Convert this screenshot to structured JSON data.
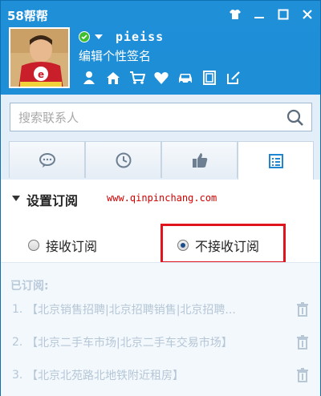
{
  "app": {
    "title": "58帮帮"
  },
  "profile": {
    "username": "pieiss",
    "signature": "编辑个性签名",
    "status": "online"
  },
  "quick_icons": [
    "person-icon",
    "home-icon",
    "cart-icon",
    "heart-icon",
    "car-icon",
    "notebook-icon",
    "edit-icon"
  ],
  "search": {
    "placeholder": "搜索联系人"
  },
  "tabs": [
    {
      "name": "chat-icon"
    },
    {
      "name": "clock-icon"
    },
    {
      "name": "thumbs-up-icon"
    },
    {
      "name": "list-icon",
      "active": true
    }
  ],
  "subscription": {
    "section_title": "设置订阅",
    "watermark": "www.qinpinchang.com",
    "option_accept": "接收订阅",
    "option_reject": "不接收订阅",
    "selected": "reject",
    "subscribed_label": "已订阅:",
    "items": [
      {
        "num": "1.",
        "text": "【北京销售招聘|北京招聘销售|北京招聘..."
      },
      {
        "num": "2.",
        "text": "【北京二手车市场|北京二手车交易市场】"
      },
      {
        "num": "3.",
        "text": "【北京北苑路北地铁附近租房】"
      }
    ]
  },
  "colors": {
    "header_blue": "#1e8fd6",
    "highlight_red": "#e0141c",
    "watermark_red": "#d40000"
  }
}
